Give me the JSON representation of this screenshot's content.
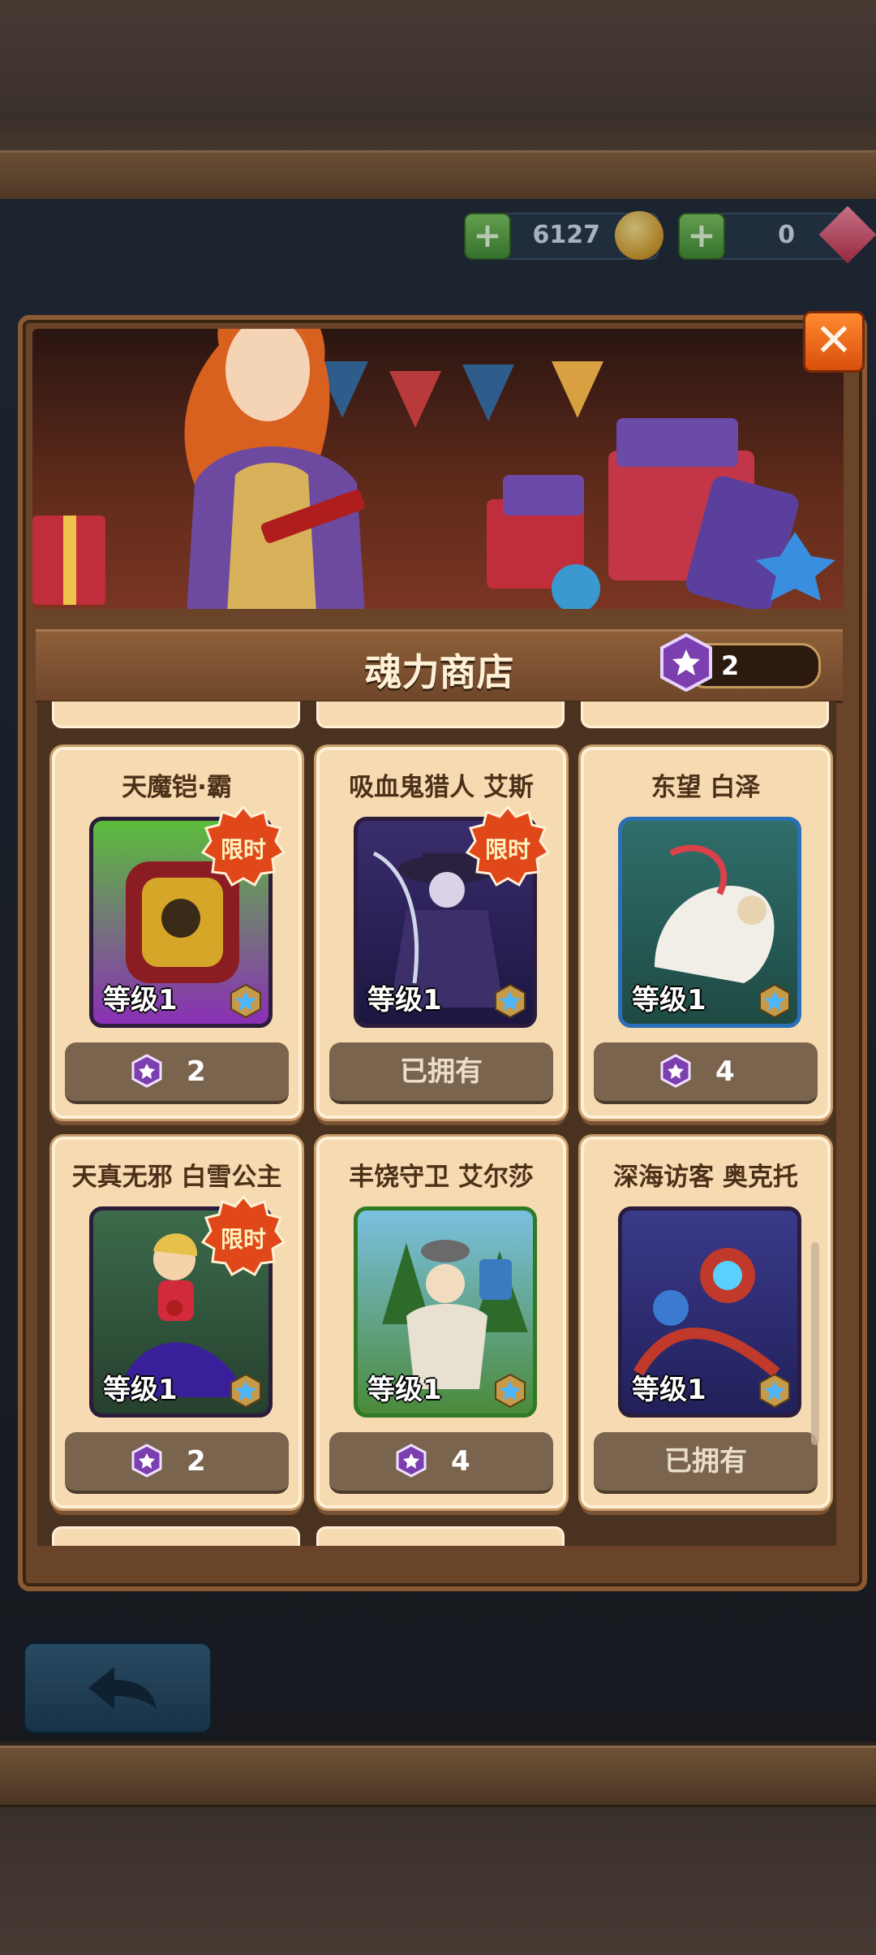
{
  "currency": {
    "gold_amount": "6127",
    "gem_amount": "0",
    "gold_icon": "gold-coin-icon",
    "gem_icon": "red-gem-icon",
    "add_icon": "plus-icon"
  },
  "shop": {
    "title": "魂力商店",
    "soul_balance": "2",
    "close_icon": "close-icon"
  },
  "items": [
    {
      "name": "天魔铠·霸",
      "level": "等级1",
      "limited": "限时",
      "price": "2",
      "owned": false
    },
    {
      "name": "吸血鬼猎人 艾斯",
      "level": "等级1",
      "limited": "限时",
      "price": "已拥有",
      "owned": true
    },
    {
      "name": "东望 白泽",
      "level": "等级1",
      "limited": "",
      "price": "4",
      "owned": false
    },
    {
      "name": "天真无邪 白雪公主",
      "level": "等级1",
      "limited": "限时",
      "price": "2",
      "owned": false
    },
    {
      "name": "丰饶守卫 艾尔莎",
      "level": "等级1",
      "limited": "",
      "price": "4",
      "owned": false
    },
    {
      "name": "深海访客 奥克托",
      "level": "等级1",
      "limited": "",
      "price": "已拥有",
      "owned": true
    }
  ],
  "colors": {
    "card_bg": "#f6dab1",
    "button_bg": "#7a644d",
    "accent_orange": "#e8591a",
    "soul_gem": "#7b3fb0"
  },
  "navigation": {
    "back_icon": "back-arrow-icon"
  }
}
